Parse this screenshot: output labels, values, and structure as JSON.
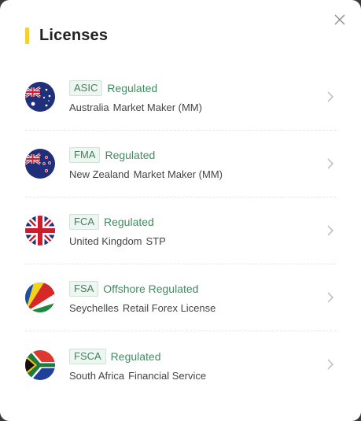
{
  "modal": {
    "title": "Licenses",
    "accent_color": "#f7cf2f",
    "close_icon": "close-icon"
  },
  "licenses": [
    {
      "code": "ASIC",
      "status": "Regulated",
      "country": "Australia",
      "type": "Market Maker (MM)",
      "flag": "australia-flag-icon"
    },
    {
      "code": "FMA",
      "status": "Regulated",
      "country": "New Zealand",
      "type": "Market Maker (MM)",
      "flag": "new-zealand-flag-icon"
    },
    {
      "code": "FCA",
      "status": "Regulated",
      "country": "United Kingdom",
      "type": "STP",
      "flag": "united-kingdom-flag-icon"
    },
    {
      "code": "FSA",
      "status": "Offshore Regulated",
      "country": "Seychelles",
      "type": "Retail Forex License",
      "flag": "seychelles-flag-icon"
    },
    {
      "code": "FSCA",
      "status": "Regulated",
      "country": "South Africa",
      "type": "Financial Service",
      "flag": "south-africa-flag-icon"
    }
  ]
}
